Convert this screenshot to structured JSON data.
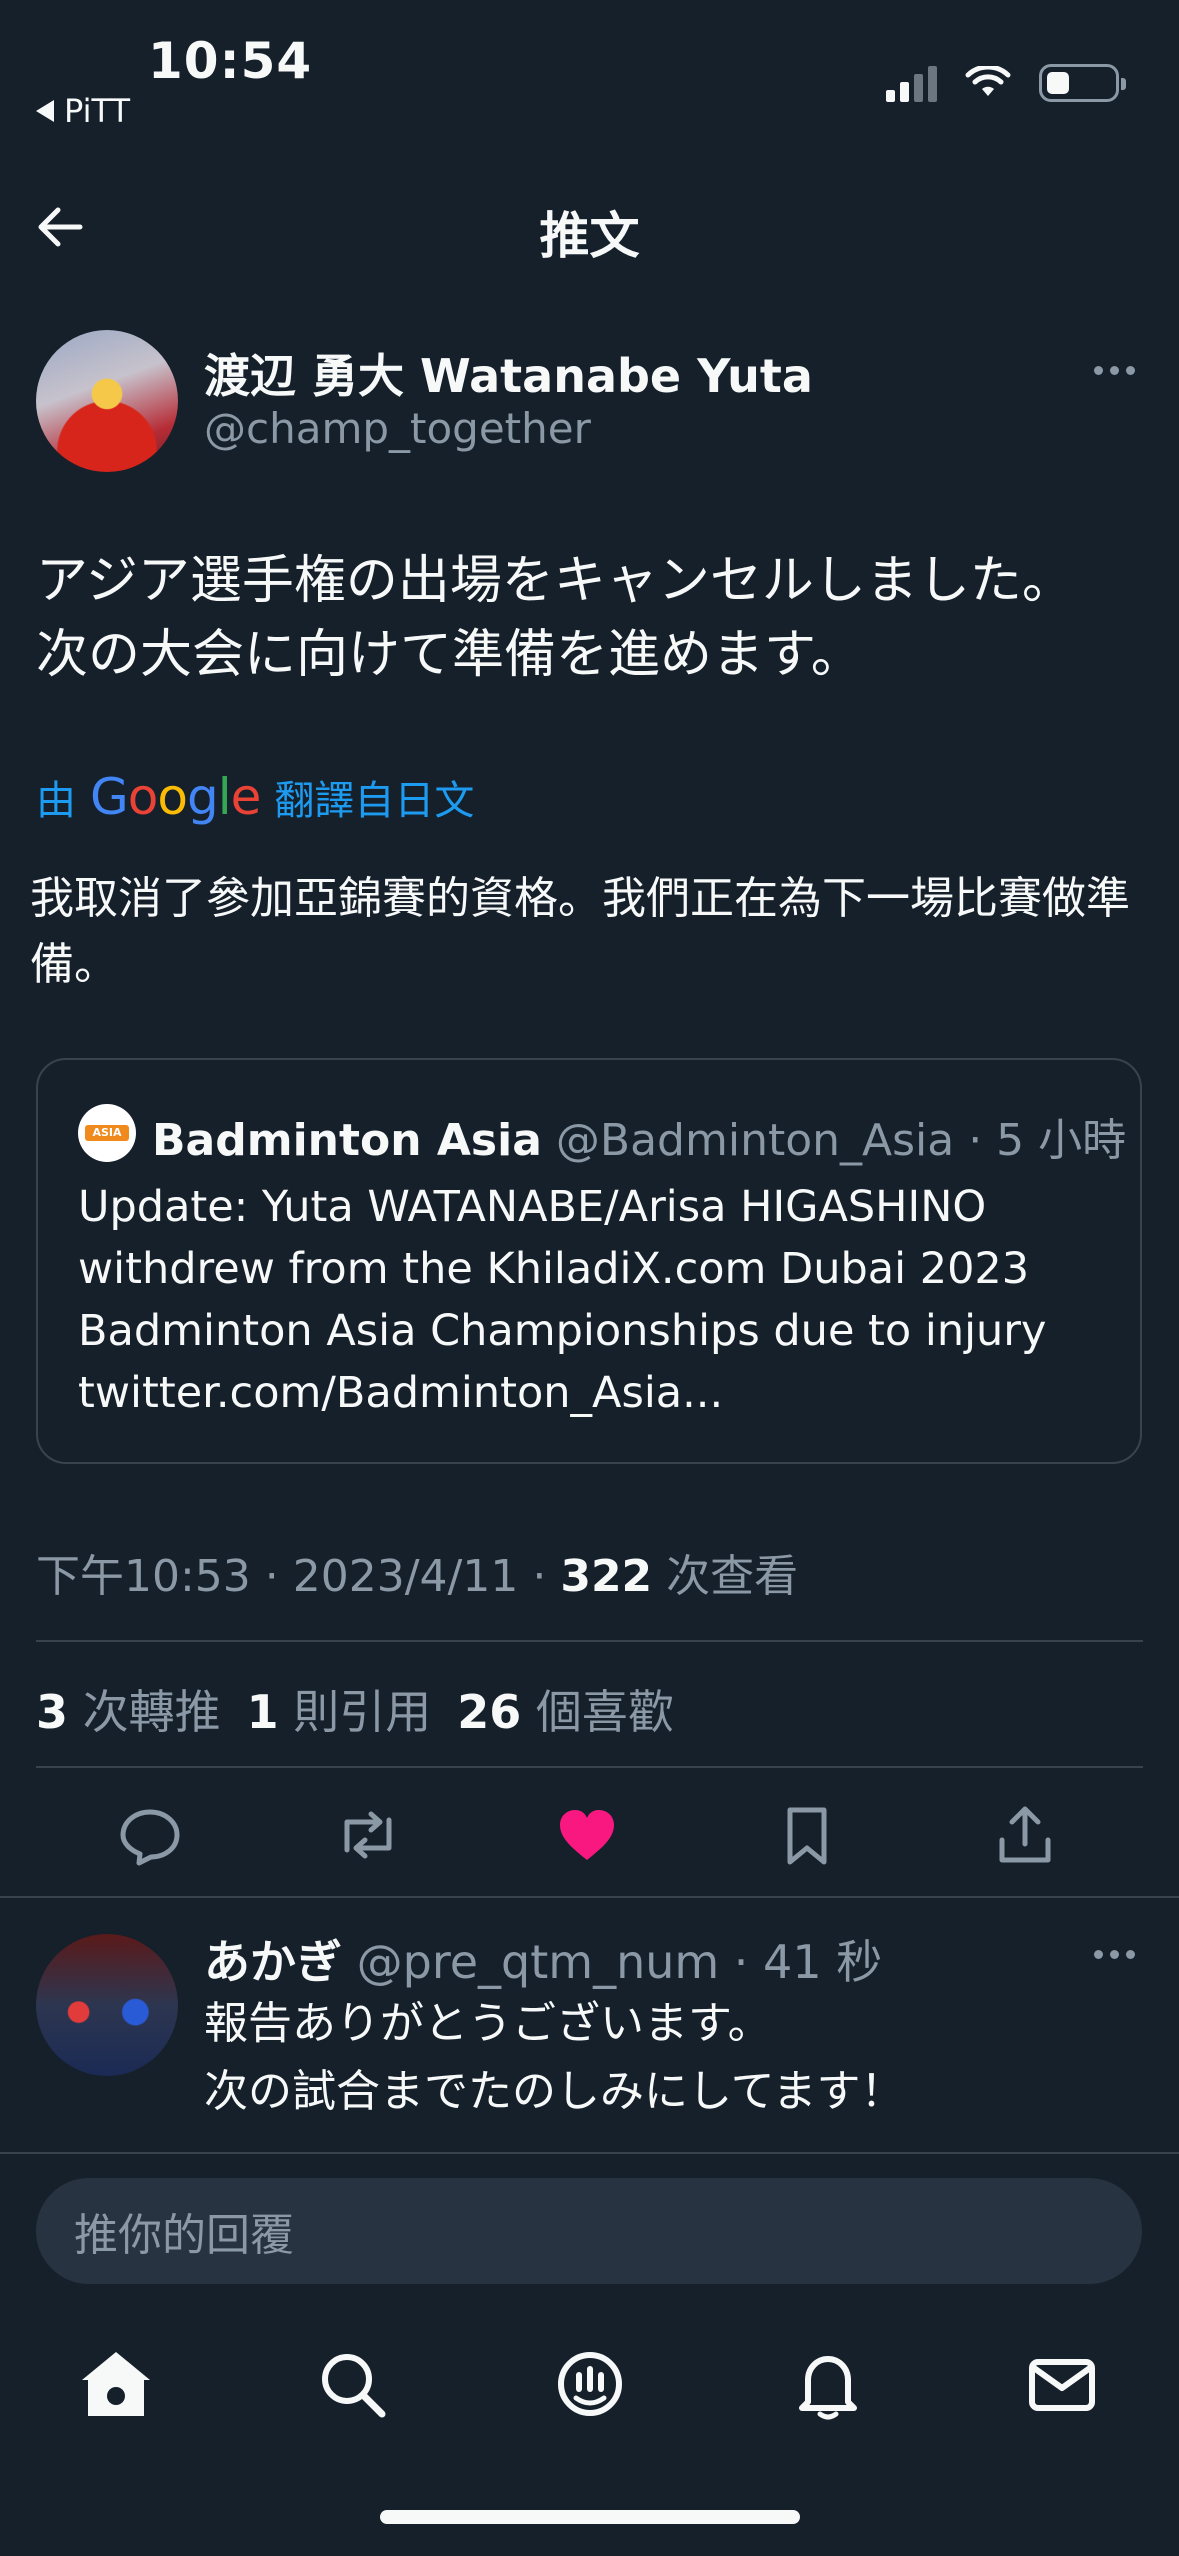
{
  "status_bar": {
    "time": "10:54",
    "back_app": "PiTT"
  },
  "header": {
    "title": "推文"
  },
  "tweet": {
    "author_name": "渡辺 勇大 Watanabe Yuta",
    "author_handle": "@champ_together",
    "text": "アジア選手権の出場をキャンセルしました。\n次の大会に向けて準備を進めます。",
    "translate_prefix": "由",
    "translate_brand": "Google",
    "translate_suffix": "翻譯自日文",
    "translated_text": "我取消了參加亞錦賽的資格。我們正在為下一場比賽做準備。",
    "quote": {
      "name": "Badminton Asia",
      "meta": "@Badminton_Asia · 5 小時",
      "avatar_badge": "ASIA",
      "text": "Update: Yuta WATANABE/Arisa HIGASHINO\nwithdrew from the KhiladiX.com Dubai 2023\nBadminton Asia Championships due to injury\ntwitter.com/Badminton_Asia..."
    },
    "timestamp": "下午10:53 · 2023/4/11 · ",
    "views_count": "322",
    "views_label": " 次查看",
    "stats": {
      "retweets_count": "3",
      "retweets_label": " 次轉推",
      "quotes_count": "1",
      "quotes_label": " 則引用",
      "likes_count": "26",
      "likes_label": " 個喜歡"
    },
    "liked": true,
    "like_color": "#f91880"
  },
  "reply": {
    "name": "あかぎ",
    "meta": " @pre_qtm_num · 41 秒",
    "text": "報告ありがとうございます。\n次の試合までたのしみにしてます！"
  },
  "composer": {
    "placeholder": "推你的回覆"
  },
  "nav": [
    "home-icon",
    "search-icon",
    "spaces-icon",
    "notifications-icon",
    "messages-icon"
  ]
}
